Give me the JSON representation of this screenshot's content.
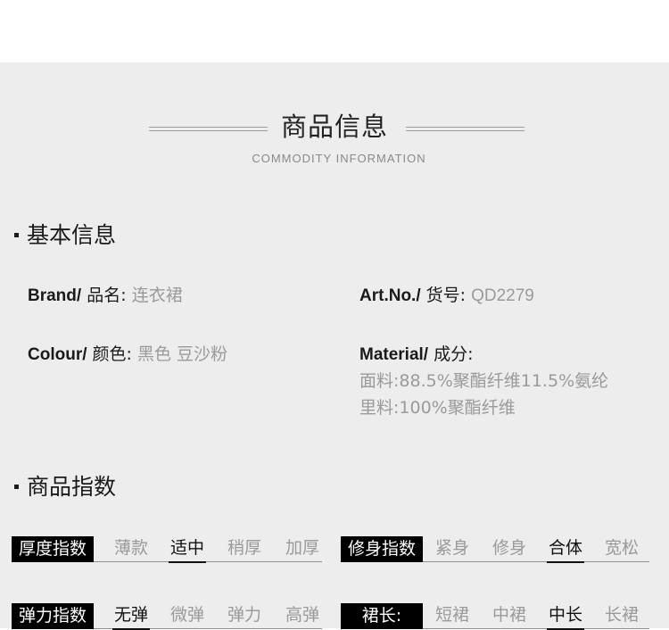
{
  "header": {
    "title": "商品信息",
    "subtitle": "COMMODITY INFORMATION"
  },
  "basic_info": {
    "heading": "基本信息",
    "brand": {
      "label_en": "Brand/",
      "label_cn": "品名:",
      "value": "连衣裙"
    },
    "art_no": {
      "label_en": "Art.No./",
      "label_cn": "货号:",
      "value": "QD2279"
    },
    "colour": {
      "label_en": "Colour/",
      "label_cn": "颜色:",
      "value": "黑色 豆沙粉"
    },
    "material": {
      "label_en": "Material/",
      "label_cn": "成分:",
      "lines": [
        "面料:88.5%聚酯纤维11.5%氨纶",
        "里料:100%聚酯纤维"
      ]
    }
  },
  "index": {
    "heading": "商品指数",
    "rows": [
      {
        "label": "厚度指数",
        "options": [
          "薄款",
          "适中",
          "稍厚",
          "加厚"
        ],
        "selected": "适中"
      },
      {
        "label": "修身指数",
        "options": [
          "紧身",
          "修身",
          "合体",
          "宽松"
        ],
        "selected": "合体"
      },
      {
        "label": "弹力指数",
        "options": [
          "无弹",
          "微弹",
          "弹力",
          "高弹"
        ],
        "selected": "无弹"
      },
      {
        "label": "裙长:",
        "options": [
          "短裙",
          "中裙",
          "中长",
          "长裙"
        ],
        "selected": "中长"
      }
    ]
  }
}
